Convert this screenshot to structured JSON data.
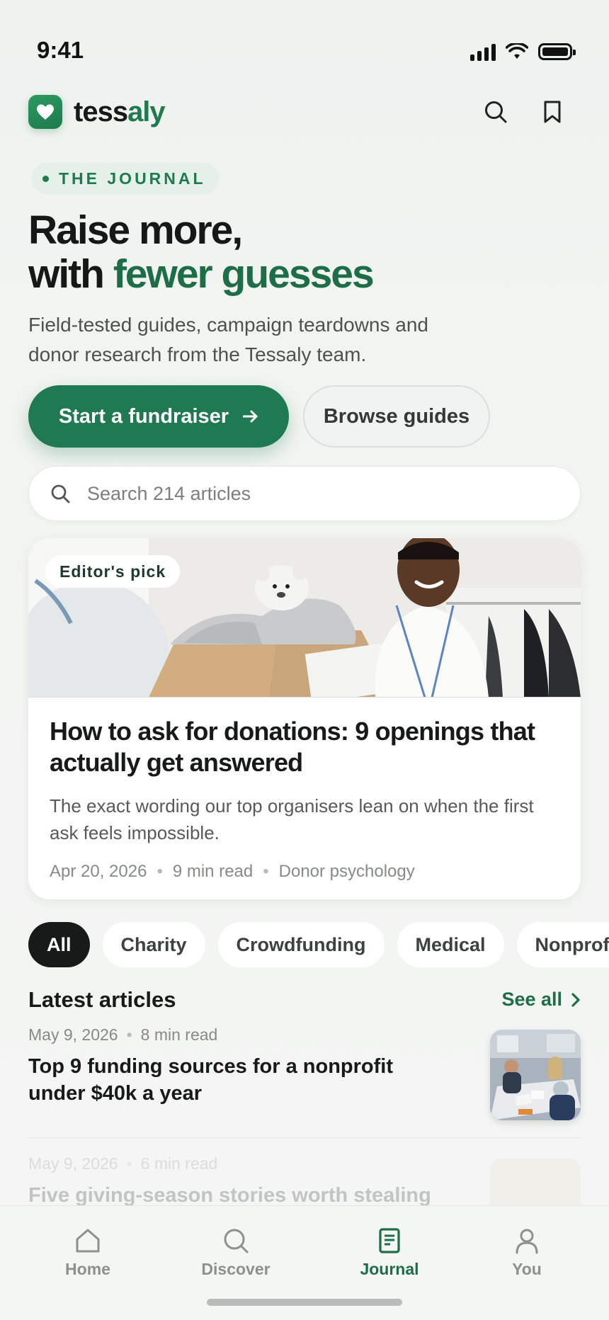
{
  "status_bar": {
    "time": "9:41"
  },
  "brand": {
    "name_prefix": "tess",
    "name_highlight": "aly"
  },
  "hero": {
    "eyebrow": "THE JOURNAL",
    "title_line1": "Raise more,",
    "title_line2_prefix": "with ",
    "title_line2_accent": "fewer guesses",
    "subtitle": "Field-tested guides, campaign teardowns and donor research from the Tessaly team.",
    "primary_button": "Start a fundraiser",
    "secondary_button": "Browse guides"
  },
  "search": {
    "placeholder": "Search 214 articles"
  },
  "featured": {
    "badge": "Editor's pick",
    "title": "How to ask for donations: 9 openings that actually get answered",
    "description": "The exact wording our top organisers lean on when the first ask feels impossible.",
    "date": "Apr 20, 2026",
    "read_time": "9 min read",
    "category": "Donor psychology"
  },
  "filters": {
    "chips": [
      "All",
      "Charity",
      "Crowdfunding",
      "Medical",
      "Nonprofit"
    ],
    "active_index": 0
  },
  "latest": {
    "title": "Latest articles",
    "see_all": "See all",
    "articles": [
      {
        "date": "May 9, 2026",
        "read_time": "8 min read",
        "title": "Top 9 funding sources for a nonprofit under $40k a year"
      },
      {
        "date": "May 9, 2026",
        "read_time": "6 min read",
        "title": "Five giving-season stories worth stealing the"
      }
    ]
  },
  "nav": {
    "items": [
      {
        "label": "Home",
        "icon": "home-icon"
      },
      {
        "label": "Discover",
        "icon": "search-icon"
      },
      {
        "label": "Journal",
        "icon": "journal-icon"
      },
      {
        "label": "You",
        "icon": "user-icon"
      }
    ],
    "active": "Journal"
  },
  "colors": {
    "brand_green": "#1f7a52",
    "accent_text": "#1d6e46",
    "chip_active": "#161a18"
  }
}
